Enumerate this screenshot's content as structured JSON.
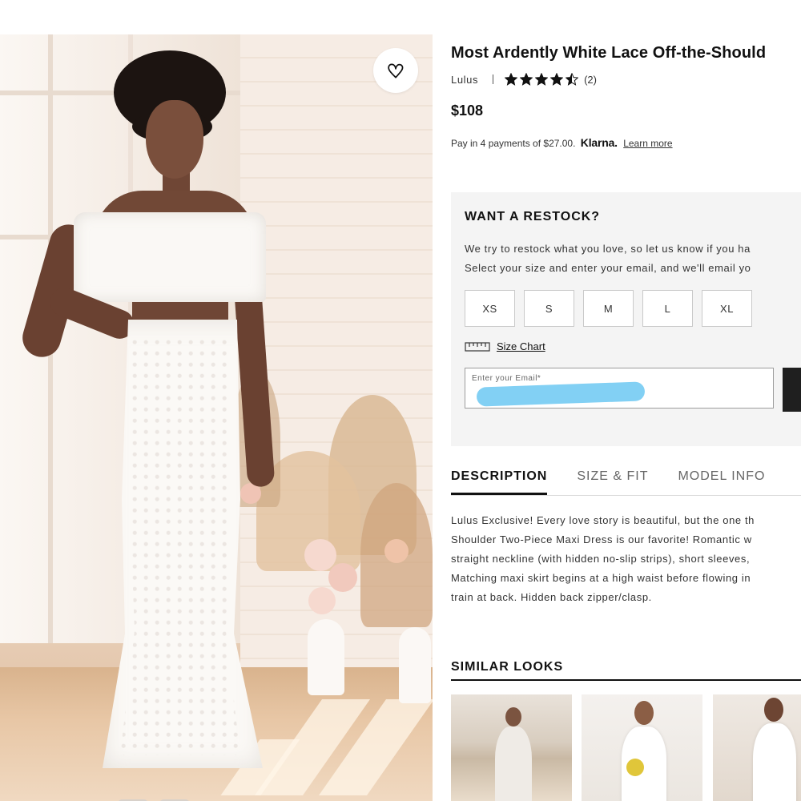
{
  "product": {
    "title": "Most Ardently White Lace Off-the-Should",
    "brand": "Lulus",
    "rating": 4.5,
    "rating_max": 5,
    "review_count": "(2)",
    "price": "$108",
    "payment": {
      "text": "Pay in 4 payments of $27.00.",
      "provider": "Klarna.",
      "link": "Learn more"
    }
  },
  "wishlist": {
    "icon": "heart-icon"
  },
  "restock": {
    "title": "WANT A RESTOCK?",
    "line1": "We try to restock what you love, so let us know if you ha",
    "line2": "Select your size and enter your email, and we'll email yo",
    "sizes": [
      "XS",
      "S",
      "M",
      "L",
      "XL"
    ],
    "size_chart_label": "Size Chart",
    "size_chart_icon": "ruler-icon",
    "email_label": "Enter your Email*"
  },
  "tabs": [
    {
      "label": "DESCRIPTION",
      "active": true
    },
    {
      "label": "SIZE & FIT",
      "active": false
    },
    {
      "label": "MODEL INFO",
      "active": false
    }
  ],
  "description": [
    "Lulus Exclusive! Every love story is beautiful, but the one th",
    "Shoulder Two-Piece Maxi Dress is our favorite! Romantic w",
    "straight neckline (with hidden no-slip strips), short sleeves,",
    "Matching maxi skirt begins at a high waist before flowing in",
    "train at back. Hidden back zipper/clasp."
  ],
  "similar": {
    "title": "SIMILAR LOOKS"
  },
  "colors": {
    "accent": "#111111",
    "restock_bg": "#f4f4f4",
    "redaction": "#82d0f4"
  }
}
